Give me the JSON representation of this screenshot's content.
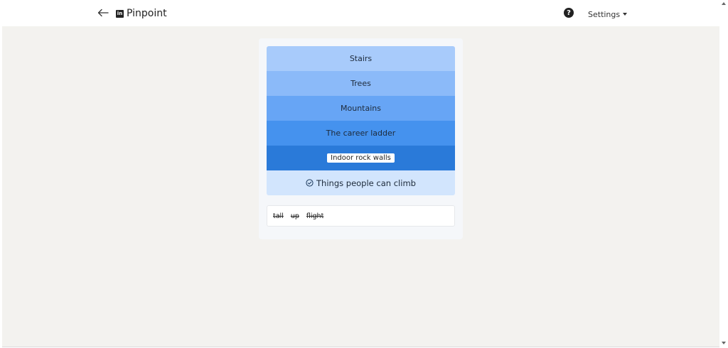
{
  "header": {
    "brand_name": "Pinpoint",
    "brand_logo_text": "in",
    "help_glyph": "?",
    "settings_label": "Settings",
    "icons": {
      "back": "arrow-left-icon",
      "logo": "linkedin-logo-icon",
      "help": "question-circle-icon",
      "settings_caret": "caret-down-icon"
    }
  },
  "puzzle": {
    "clues": [
      {
        "label": "Stairs"
      },
      {
        "label": "Trees"
      },
      {
        "label": "Mountains"
      },
      {
        "label": "The career ladder"
      },
      {
        "label": "Indoor rock walls"
      }
    ],
    "answer": "Things people can climb",
    "answer_icon": "check-circle-icon",
    "guesses": [
      "tall",
      "up",
      "flight"
    ]
  },
  "colors": {
    "clue_1": "#a8cbfb",
    "clue_2": "#8bbaf9",
    "clue_3": "#67a5f5",
    "clue_4": "#4592ee",
    "clue_5": "#2a7ad9",
    "answer_bg": "#d2e5fd",
    "page_bg": "#f3f2ef"
  }
}
